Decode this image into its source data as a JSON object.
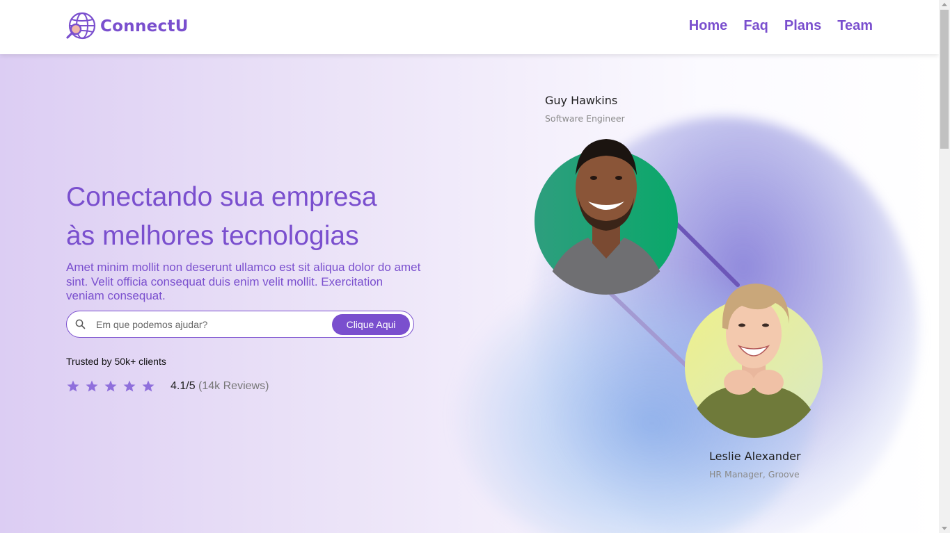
{
  "header": {
    "logo_text": "ConnectU",
    "logo_icon": "globe-search-icon",
    "nav": [
      {
        "label": "Home"
      },
      {
        "label": "Faq"
      },
      {
        "label": "Plans"
      },
      {
        "label": "Team"
      }
    ]
  },
  "hero": {
    "headline_line1": "Conectando sua empresa",
    "headline_line2": "às melhores tecnologias",
    "subtext": "Amet minim mollit non deserunt ullamco est sit aliqua dolor do amet sint. Velit officia consequat duis enim velit mollit. Exercitation veniam consequat.",
    "search": {
      "placeholder": "Em que podemos ajudar?",
      "value": "",
      "button_label": "Clique Aqui",
      "icon": "search-icon"
    },
    "trusted_text": "Trusted by 50k+ clients",
    "rating": {
      "stars": 5,
      "score": "4.1/5",
      "reviews": "(14k Reviews)"
    }
  },
  "people": [
    {
      "name": "Guy Hawkins",
      "role": "Software Engineer"
    },
    {
      "name": "Leslie Alexander",
      "role": "HR Manager, Groove"
    }
  ],
  "colors": {
    "accent": "#7a4fce",
    "star": "#8f6fdc",
    "green_bg": "#12a77a",
    "yellow_bg": "#e6ea9a"
  }
}
